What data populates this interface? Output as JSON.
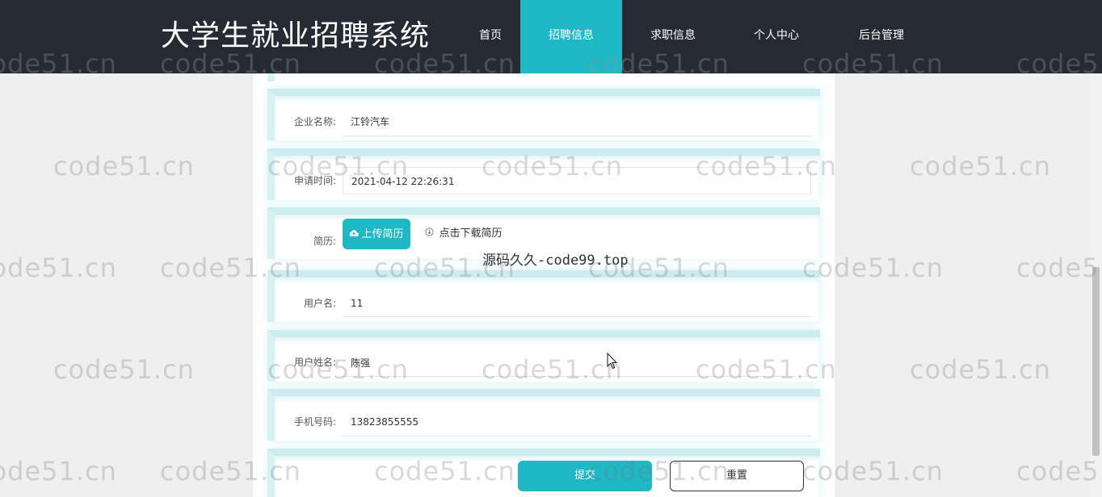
{
  "header": {
    "brand": "大学生就业招聘系统",
    "nav": [
      "首页",
      "招聘信息",
      "求职信息",
      "个人中心",
      "后台管理"
    ],
    "active_index": 1
  },
  "form": {
    "company_label": "企业名称:",
    "company_value": "江铃汽车",
    "apply_time_label": "申请时间:",
    "apply_time_value": "2021-04-12 22:26:31",
    "resume_label": "简历:",
    "upload_label": "上传简历",
    "download_label": "点击下载简历",
    "username_label": "用户名:",
    "username_value": "11",
    "realname_label": "用户姓名:",
    "realname_value": "陈强",
    "phone_label": "手机号码:",
    "phone_value": "13823855555",
    "submit_label": "提交",
    "reset_label": "重置"
  },
  "watermark": {
    "text": "code51.cn",
    "center_text": "源码久久-code99.top"
  },
  "colors": {
    "accent": "#1fb8c6",
    "header_bg": "#252a33",
    "page_bg": "#efefef"
  },
  "icons": {
    "upload": "cloud-upload-icon",
    "download": "download-circle-icon",
    "cursor": "mouse-pointer-icon"
  }
}
